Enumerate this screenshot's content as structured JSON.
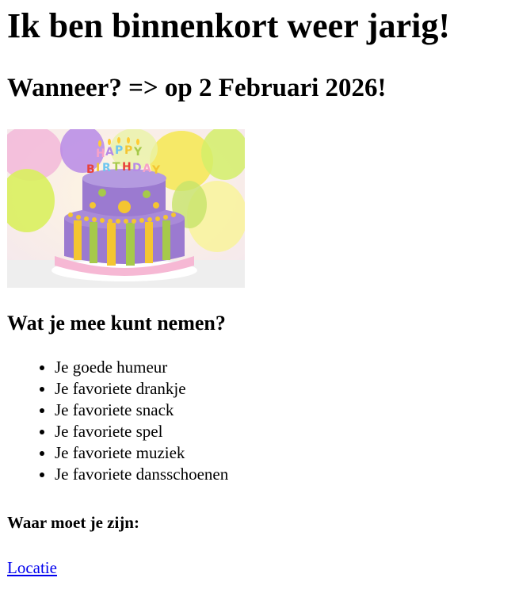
{
  "heading": "Ik ben binnenkort weer jarig!",
  "subheading": "Wanneer? => op 2 Februari 2026!",
  "image": {
    "topper_text": "HAPPY BIRTHDAY",
    "colors": {
      "cake_purple": "#9b7ad0",
      "ribbon_pink": "#f6b8d4",
      "stripe_yellow": "#f4c531",
      "stripe_green": "#a6c94a",
      "balloon_yellow": "#e9f05a",
      "balloon_purple": "#b78ae6"
    }
  },
  "bring_section": {
    "title": "Wat je mee kunt nemen?",
    "items": [
      "Je goede humeur",
      "Je favoriete drankje",
      "Je favoriete snack",
      "Je favoriete spel",
      "Je favoriete muziek",
      "Je favoriete dansschoenen"
    ]
  },
  "location_section": {
    "title": "Waar moet je zijn:",
    "link_label": "Locatie"
  }
}
